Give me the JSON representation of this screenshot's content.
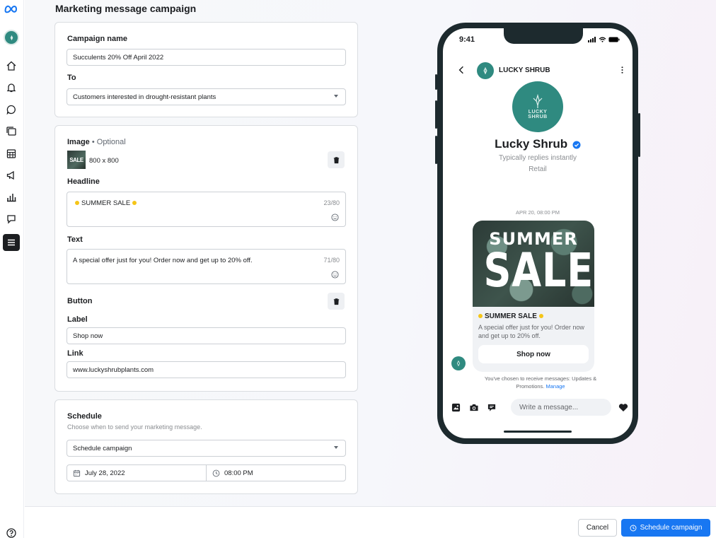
{
  "page_title": "Marketing message campaign",
  "campaign": {
    "name_label": "Campaign name",
    "name_value": "Succulents 20% Off April 2022",
    "to_label": "To",
    "to_value": "Customers interested in drought-resistant plants"
  },
  "content": {
    "image_label": "Image",
    "image_optional": " • Optional",
    "image_thumb_text": "SALE",
    "image_size": "800 x 800",
    "headline_label": "Headline",
    "headline_value": "SUMMER SALE",
    "headline_count": "23/80",
    "text_label": "Text",
    "text_value": "A special offer just for you! Order now and get up to 20% off.",
    "text_count": "71/80",
    "button_label": "Button",
    "label_label": "Label",
    "label_value": "Shop now",
    "link_label": "Link",
    "link_value": "www.luckyshrubplants.com"
  },
  "schedule": {
    "title": "Schedule",
    "subtitle": "Choose when to send your marketing message.",
    "mode_value": "Schedule campaign",
    "date_value": "July 28, 2022",
    "time_value": "08:00 PM"
  },
  "preview": {
    "time": "9:41",
    "header_name": "LUCKY SHRUB",
    "avatar_text_1": "LUCKY",
    "avatar_text_2": "SHRUB",
    "page_name": "Lucky Shrub",
    "replies": "Typically replies instantly",
    "category": "Retail",
    "timestamp": "APR 20, 08:00 PM",
    "hero_line1": "SUMMER",
    "hero_line2": "SALE",
    "card_headline": "SUMMER SALE",
    "card_text": "A special offer just for you! Order now and get up to 20% off.",
    "card_button": "Shop now",
    "consent_text": "You've chosen to receive messages: Updates & Promotions.",
    "consent_link": "Manage",
    "composer_placeholder": "Write a message..."
  },
  "footer": {
    "cancel": "Cancel",
    "schedule": "Schedule campaign"
  },
  "colors": {
    "brand": "#1877f2",
    "teal": "#2f8a80",
    "dark": "#1d2a2e"
  },
  "rail_icons": [
    "meta-logo-icon",
    "account-avatar",
    "home-icon",
    "notifications-icon",
    "chat-icon",
    "content-icon",
    "planner-icon",
    "ads-icon",
    "insights-icon",
    "inbox-icon",
    "menu-icon",
    "help-icon"
  ]
}
